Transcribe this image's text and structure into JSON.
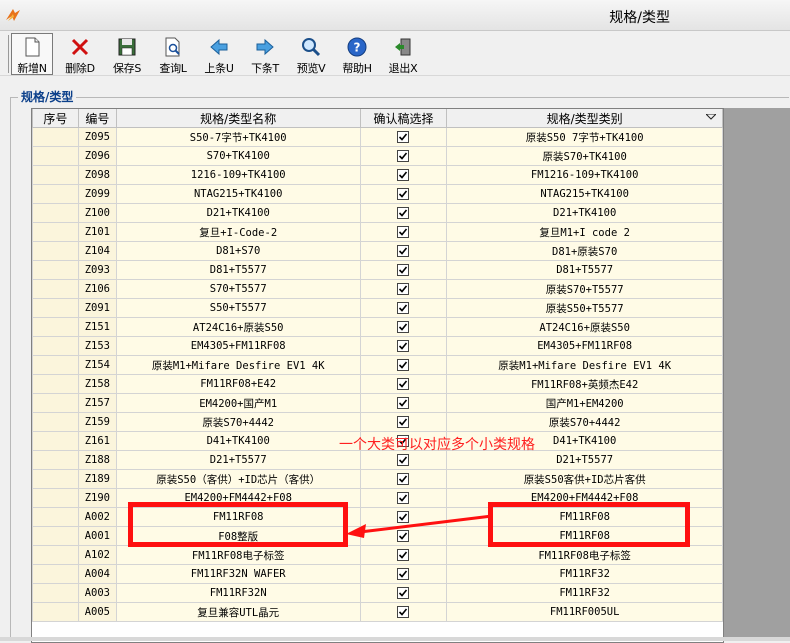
{
  "window": {
    "title": "规格/类型"
  },
  "toolbar": [
    {
      "id": "new",
      "label": "新增N",
      "icon": "new-document-icon"
    },
    {
      "id": "delete",
      "label": "删除D",
      "icon": "delete-x-icon"
    },
    {
      "id": "save",
      "label": "保存S",
      "icon": "floppy-save-icon"
    },
    {
      "id": "query",
      "label": "查询L",
      "icon": "document-search-icon"
    },
    {
      "id": "prev",
      "label": "上条U",
      "icon": "arrow-left-icon"
    },
    {
      "id": "next",
      "label": "下条T",
      "icon": "arrow-right-icon"
    },
    {
      "id": "preview",
      "label": "预览V",
      "icon": "magnifier-icon"
    },
    {
      "id": "help",
      "label": "帮助H",
      "icon": "help-question-icon"
    },
    {
      "id": "exit",
      "label": "退出X",
      "icon": "exit-door-icon"
    }
  ],
  "group": {
    "title": "规格/类型"
  },
  "grid": {
    "columns": [
      "序号",
      "编号",
      "规格/类型名称",
      "确认稿选择",
      "规格/类型类别"
    ],
    "rows": [
      {
        "code": "Z095",
        "name": "S50-7字节+TK4100",
        "checked": true,
        "category": "原装S50 7字节+TK4100"
      },
      {
        "code": "Z096",
        "name": "S70+TK4100",
        "checked": true,
        "category": "原装S70+TK4100"
      },
      {
        "code": "Z098",
        "name": "1216-109+TK4100",
        "checked": true,
        "category": "FM1216-109+TK4100"
      },
      {
        "code": "Z099",
        "name": "NTAG215+TK4100",
        "checked": true,
        "category": "NTAG215+TK4100"
      },
      {
        "code": "Z100",
        "name": "D21+TK4100",
        "checked": true,
        "category": "D21+TK4100"
      },
      {
        "code": "Z101",
        "name": "复旦+I-Code-2",
        "checked": true,
        "category": "复旦M1+I code 2"
      },
      {
        "code": "Z104",
        "name": "D81+S70",
        "checked": true,
        "category": "D81+原装S70"
      },
      {
        "code": "Z093",
        "name": "D81+T5577",
        "checked": true,
        "category": "D81+T5577"
      },
      {
        "code": "Z106",
        "name": "S70+T5577",
        "checked": true,
        "category": "原装S70+T5577"
      },
      {
        "code": "Z091",
        "name": "S50+T5577",
        "checked": true,
        "category": "原装S50+T5577"
      },
      {
        "code": "Z151",
        "name": "AT24C16+原装S50",
        "checked": true,
        "category": "AT24C16+原装S50"
      },
      {
        "code": "Z153",
        "name": "EM4305+FM11RF08",
        "checked": true,
        "category": "EM4305+FM11RF08"
      },
      {
        "code": "Z154",
        "name": "原装M1+Mifare Desfire EV1 4K",
        "checked": true,
        "category": "原装M1+Mifare Desfire EV1 4K"
      },
      {
        "code": "Z158",
        "name": "FM11RF08+E42",
        "checked": true,
        "category": "FM11RF08+英频杰E42"
      },
      {
        "code": "Z157",
        "name": "EM4200+国产M1",
        "checked": true,
        "category": "国产M1+EM4200"
      },
      {
        "code": "Z159",
        "name": "原装S70+4442",
        "checked": true,
        "category": "原装S70+4442"
      },
      {
        "code": "Z161",
        "name": "D41+TK4100",
        "checked": true,
        "category": "D41+TK4100"
      },
      {
        "code": "Z188",
        "name": "D21+T5577",
        "checked": true,
        "category": "D21+T5577"
      },
      {
        "code": "Z189",
        "name": "原装S50（客供）+ID芯片（客供）",
        "checked": true,
        "category": "原装S50客供+ID芯片客供"
      },
      {
        "code": "Z190",
        "name": "EM4200+FM4442+F08",
        "checked": true,
        "category": "EM4200+FM4442+F08"
      },
      {
        "code": "A002",
        "name": "FM11RF08",
        "checked": true,
        "category": "FM11RF08"
      },
      {
        "code": "A001",
        "name": "F08整版",
        "checked": true,
        "category": "FM11RF08"
      },
      {
        "code": "A102",
        "name": "FM11RF08电子标签",
        "checked": true,
        "category": "FM11RF08电子标签"
      },
      {
        "code": "A004",
        "name": "FM11RF32N WAFER",
        "checked": true,
        "category": "FM11RF32"
      },
      {
        "code": "A003",
        "name": "FM11RF32N",
        "checked": true,
        "category": "FM11RF32"
      },
      {
        "code": "A005",
        "name": "复旦兼容UTL晶元",
        "checked": true,
        "category": "FM11RF005UL"
      }
    ]
  },
  "annotation": {
    "text": "一个大类可以对应多个小类规格",
    "color": "#ff1010"
  }
}
